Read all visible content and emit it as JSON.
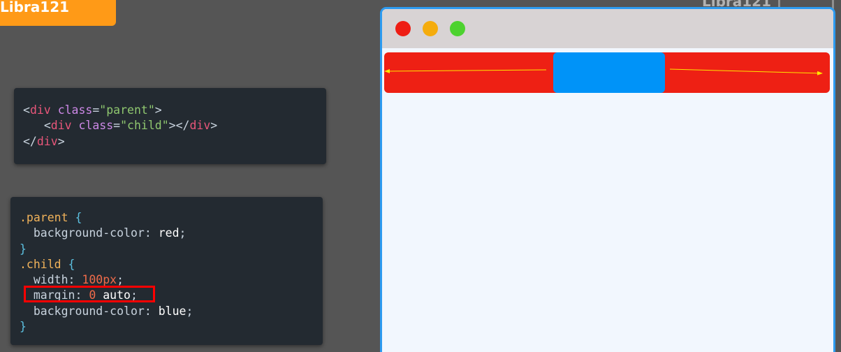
{
  "badge": {
    "text": "Libra121"
  },
  "watermark": {
    "text": "Libra121"
  },
  "html_code": {
    "line1": {
      "open": "<",
      "tag": "div",
      "attr": "class",
      "eq": "=",
      "str": "\"parent\"",
      "close": ">"
    },
    "line2": {
      "indent": "   ",
      "open": "<",
      "tag": "div",
      "attr": "class",
      "eq": "=",
      "str": "\"child\"",
      "mid": "></",
      "tag2": "div",
      "close": ">"
    },
    "line3": {
      "open": "</",
      "tag": "div",
      "close": ">"
    }
  },
  "css_code": {
    "parent_selector": ".parent",
    "open_brace": "{",
    "close_brace": "}",
    "parent_prop": "background-color",
    "parent_val": "red",
    "child_selector": ".child",
    "width_prop": "width",
    "width_val": "100px",
    "margin_prop": "margin",
    "margin_num": "0",
    "margin_auto": "auto",
    "bg_prop": "background-color",
    "bg_val": "blue",
    "colon": ":",
    "semicolon": ";"
  },
  "colors": {
    "badge": "#ff9a17",
    "parent": "#ee2014",
    "child": "#0093f8",
    "window_border": "#2d9bf0",
    "highlight": "#ff0000",
    "arrow": "#ffe600"
  },
  "icons": [
    "window-close-dot-icon",
    "window-minimize-dot-icon",
    "window-maximize-dot-icon",
    "left-arrow-icon",
    "right-arrow-icon"
  ]
}
